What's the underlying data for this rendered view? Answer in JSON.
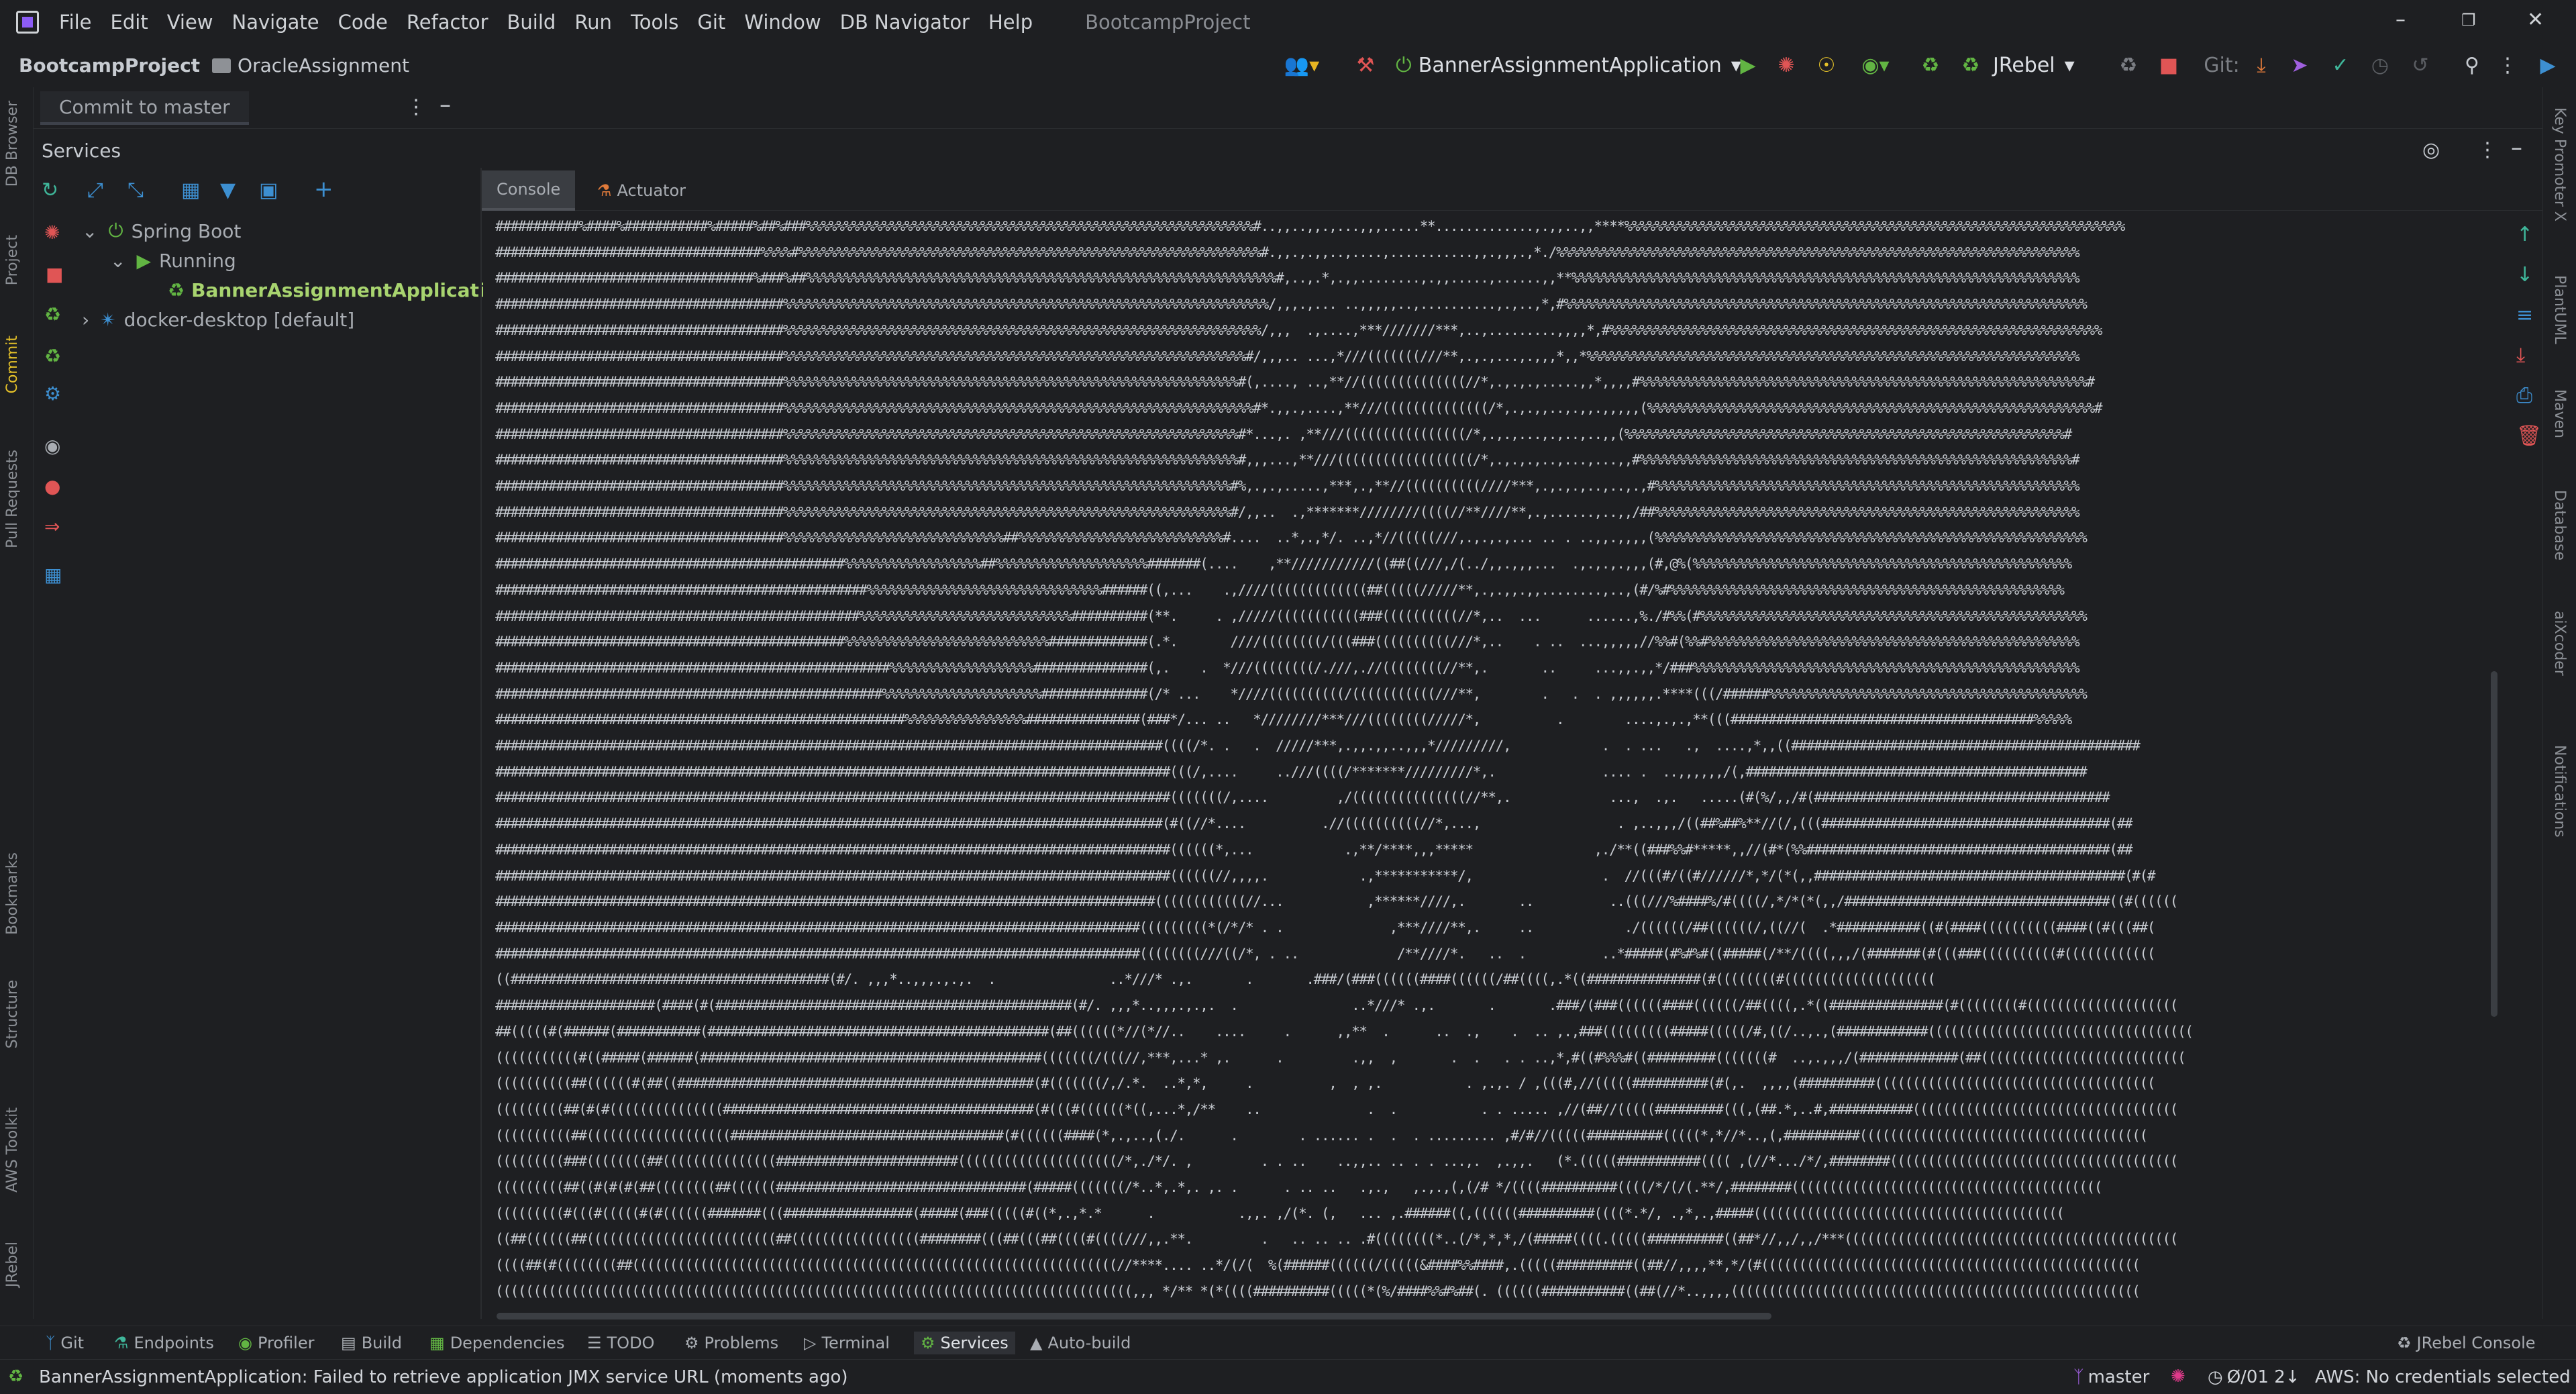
{
  "menubar": {
    "items": [
      "File",
      "Edit",
      "View",
      "Navigate",
      "Code",
      "Refactor",
      "Build",
      "Run",
      "Tools",
      "Git",
      "Window",
      "DB Navigator",
      "Help"
    ],
    "app_title": "BootcampProject"
  },
  "navbar": {
    "project": "BootcampProject",
    "folder": "OracleAssignment",
    "run_config": "BannerAssignmentApplication",
    "jrebel": "JRebel",
    "git_label": "Git:"
  },
  "left_tabs": {
    "db_browser": "DB Browser",
    "project": "Project",
    "commit": "Commit",
    "pull_requests": "Pull Requests",
    "bookmarks": "Bookmarks",
    "structure": "Structure",
    "aws_toolkit": "AWS Toolkit",
    "jrebel": "JRebel"
  },
  "right_tabs": {
    "key_promoter": "Key Promoter X",
    "plantuml": "PlantUML",
    "maven": "Maven",
    "database": "Database",
    "aixcoder": "aiXcoder",
    "notifications": "Notifications"
  },
  "commit_panel": {
    "tab_label": "Commit to master"
  },
  "services": {
    "header": "Services",
    "tree": [
      {
        "label": "Spring Boot"
      },
      {
        "label": "Running"
      },
      {
        "label": "BannerAssignmentApplication"
      },
      {
        "label": "docker-desktop [default]"
      }
    ]
  },
  "console_tabs": {
    "console": "Console",
    "actuator": "Actuator"
  },
  "console": {
    "lines": [
      "###########%####%###########%#####%##%###%%%%%%%%%%%%%%%%%%%%%%%%%%%%%%%%%%%%%%%%%%%%%%%%%%%%%%%%%%%#..,,..,,.,...,,,.....**.............,.,,..,,****%%%%%%%%%%%%%%%%%%%%%%%%%%%%%%%%%%%%%%%%%%%%%%%%%%%%%%%%%%%%%%%%%%",
      "###################################%%%%#%%%%%%%%%%%%%%%%%%%%%%%%%%%%%%%%%%%%%%%%%%%%%%%%%%%%%%%%%%%%%#.,,.,.,,..,....,...........,,.,,,.,*./%%%%%%%%%%%%%%%%%%%%%%%%%%%%%%%%%%%%%%%%%%%%%%%%%%%%%%%%%%%%%%%%%%%%%",
      "##################################%###%##%%%%%%%%%%%%%%%%%%%%%%%%%%%%%%%%%%%%%%%%%%%%%%%%%%%%%%%%%%%%%%#,..,.*,.,,........,.,,.....,......,,**%%%%%%%%%%%%%%%%%%%%%%%%%%%%%%%%%%%%%%%%%%%%%%%%%%%%%%%%%%%%%%%%%%%",
      "######################################%%%%%%%%%%%%%%%%%%%%%%%%%%%%%%%%%%%%%%%%%%%%%%%%%%%%%%%%%%%%%%%%/,,,.,... ..,,,,,..,..........,.,..,*,#%%%%%%%%%%%%%%%%%%%%%%%%%%%%%%%%%%%%%%%%%%%%%%%%%%%%%%%%%%%%%%%%%%%%%",
      "######################################%%%%%%%%%%%%%%%%%%%%%%%%%%%%%%%%%%%%%%%%%%%%%%%%%%%%%%%%%%%%%%%/,,,  .,....,***///////***,..,.........,,,,*,#%%%%%%%%%%%%%%%%%%%%%%%%%%%%%%%%%%%%%%%%%%%%%%%%%%%%%%%%%%%%%%%%%",
      "######################################%%%%%%%%%%%%%%%%%%%%%%%%%%%%%%%%%%%%%%%%%%%%%%%%%%%%%%%%%%%%%#/,,,.. ...,*///(((((((///**,.,.,...,.,,,*,,*%%%%%%%%%%%%%%%%%%%%%%%%%%%%%%%%%%%%%%%%%%%%%%%%%%%%%%%%%%%%%%%%%",
      "######################################%%%%%%%%%%%%%%%%%%%%%%%%%%%%%%%%%%%%%%%%%%%%%%%%%%%%%%%%%%%%#(,...., ..,**//((((((((((((((//*,.,.,.,.....,,*,,,,#%%%%%%%%%%%%%%%%%%%%%%%%%%%%%%%%%%%%%%%%%%%%%%%%%%%%%%%%%%%#",
      "######################################%%%%%%%%%%%%%%%%%%%%%%%%%%%%%%%%%%%%%%%%%%%%%%%%%%%%%%%%%%%%%%#*.,,.,....,**///((((((((((((((/*,.,.,,..,.,,.,,,,,(%%%%%%%%%%%%%%%%%%%%%%%%%%%%%%%%%%%%%%%%%%%%%%%%%%%%%%%%%%%#",
      "######################################%%%%%%%%%%%%%%%%%%%%%%%%%%%%%%%%%%%%%%%%%%%%%%%%%%%%%%%%%%%%#*...,. ,**///((((((((((((((((/*,.,.,...,.,..,..,,(%%%%%%%%%%%%%%%%%%%%%%%%%%%%%%%%%%%%%%%%%%%%%%%%%%%%%%%%%%#",
      "######################################%%%%%%%%%%%%%%%%%%%%%%%%%%%%%%%%%%%%%%%%%%%%%%%%%%%%%%%%%%%%#,,,...,**///((((((((((((((((((/*,.,.,.,..,...,...,,#%%%%%%%%%%%%%%%%%%%%%%%%%%%%%%%%%%%%%%%%%%%%%%%%%%%%%%%%%#",
      "######################################%%%%%%%%%%%%%%%%%%%%%%%%%%%%%%%%%%%%%%%%%%%%%%%%%%%%%%%%%%%#%,.,.,.....,***,.,**//((((((((((////***,.,.,.,..,..,.,#%%%%%%%%%%%%%%%%%%%%%%%%%%%%%%%%%%%%%%%%%%%%%%%%%%%%%%%%",
      "######################################%%%%%%%%%%%%%%%%%%%%%%%%%%%%%%%%%%%%%%%%%%%%%%%%%%%%%%%%%%%#/,,..  .,*******////////((((//**////**,.,......,..,,/##%%%%%%%%%%%%%%%%%%%%%%%%%%%%%%%%%%%%%%%%%%%%%%%%%%%%%%%%",
      "######################################%%%%%%%%%%%%%%%%%%%%%%%%%%%%%##%%%%%%%%%%%%%%%%%%%%%%%%%%%#....  ..*,.,*/. ..,*//(((((///,.,.,.,... .. . ..,,.,,,,(%%%%%%%%%%%%%%%%%%%%%%%%%%%%%%%%%%%%%%%%%%%%%%%%%%%%%%%%%",
      "##############################################%%%%%%%%%%%%%%%%%%##%%%%%%%%%%%%%%%%%%%%#######(....    ,**///////////((##((///,/(../,,.,,,...  .,.,.,.,,,(#,@%(%%%%%%%%%%%%%%%%%%%%%%%%%%%%%%%%%%%%%%%%%%%%%%%%%%",
      "#################################################%%%%%%%%%%%%%%%%%%%%%%%%%%%%%%%######((,...    .,////(((((((((((((##(((((/////**,.,.,,.,,........,..,(#/%#%%%%%%%%%%%%%%%%%%%%%%%%%%%%%%%%%%%%%%%%%%%%%%%%%%%%",
      "################################################%%%%%%%%%%%%%%%%%%%%%%%%%%%%##########(**.     . ,/////(((((((((((###((((((((((//*,..  ...      ......,%./#%%(#%%%%%%%%%%%%%%%%%%%%%%%%%%%%%%%%%%%%%%%%%%%%%%%%%%%",
      "##############################################%%%%%%%%%%%%%%%%%%%%%%%%%%%#############(.*.       ////((((((((/(((###((((((((((///*,..    . ..  ...,,,,,//%%#(%%#%%%%%%%%%%%%%%%%%%%%%%%%%%%%%%%%%%%%%%%%%%%%%%%%%",
      "####################################################%%%%%%%%%%%%%%%%%%%###############(,.    .  *///((((((((/.///,.//((((((((//**,.       ..     ...,,.,,*/###%%%%%%%%%%%%%%%%%%%%%%%%%%%%%%%%%%%%%%%%%%%%%%%%%%%",
      "###################################################%%%%%%%%%%%%%%%%%%%%%##############(/* ...    *////((((((((((/(((((((((((///**,        .   .  . ,,,,,,.****(((/######%%%%%%%%%%%%%%%%%%%%%%%%%%%%%%%%%%%%%%%%%%",
      "######################################################%%%%%%%%%%%%%%%%###############(###*/... ..   *////////***///((((((((/////*,          .        ....,.,.,**(((########################################%%%%%",
      "########################################################################################((((/*. .   .  /////***,.,,.,,..,,,*/////////,            .  . ...   .,  ....,*,,((##############################################",
      "#########################################################################################(((/,....     ..///((((/*******/////////*,.              .... .  ..,,,,,,/(,#############################################",
      "#########################################################################################(((((((/,....         ,/(((((((((((((((//**,.             ...,  .,.   .....(#(%/,,/#(#######################################",
      "########################################################################################(#((//*....          .//((((((((((//*,...,                  . ,..,,,/((##%##%**//(/,(((######################################(##",
      "#########################################################################################((((((*,...            .,**/****,,,*****                ,./**((###%%#*****,,//(#*(%%########################################(##",
      "#########################################################################################((((((//,,,,.            .,***********/,                 .  //(((#/((#//////*,*/(*(,,#########################################(#(#",
      "#######################################################################################((((((((((((//...           ,******////,.       ..          ..(((///%####%/#((((/,*/*(*(,,/###################################((#((((((",
      "#####################################################################################(((((((((*(/*/* . .              ,***////**,.     ..            ./((((((/##((((((/,((//(  .*###########((#(####((((((((((####((#(((##(",
      "#####################################################################################((((((((///((/*, . ..             /**////*.   ..  .          ..*#####(#%#%#((#####(/**/((((,,,/(#######(#(((###((((((((((#((((((((((((",
      "((##########################################(#/. ,,,*..,,,.,.,.  .               ..*///* .,.       .       .###/(###((((((####((((((/##((((,.*((###############(#((((((((#((((((((((((((((((((",
      "#####################(####(#(###############################################(#/. ,,,*..,,,.,.,.  .               ..*///* .,.       .       .###/(###((((((####((((((/##((((,.*((###############(#((((((((#((((((((((((((((((((",
      "##(((((#(######(###########(#############################################(##((((((*//(*//..    ....     .      ,,**  .      ..  .,    .  .. ,.,###(((((((((#####(((((/#,((/..,.,(############(((((((((((((((((((((((((((((((((((",
      "(((((((((((#((#####(######(#############################################(((((((/(((//,***,...* ,.      .         .,,  ,       .  .   . . ..,*,#((#%%%#((#########(((((((#  ..,.,,,/(#############(##(((((((((((((((((((((((((((",
      "((((((((((##((((((#(##((###############################################(#(((((((/,/.*.  ..*,*,     .          ,  , ,.           . ,.,. / ,(((#,//(((((##########(#(,.  ,,,,(##########(((((((((((((((((((((((((((((((((((((",
      "(((((((((##(#(#(((((((((((((((#########################################(#(((#((((((*((,...*,/**    ..              .  .           . . ..... ,//(##//(((((#########(((,(##.*,..#,###########(((((((((((((((((((((((((((((((((((",
      "((((((((((##(((((((((((((((((((####################################(#((((((####(*,.,..,(./.      .        . ...... .  .  . ......... ,#/#//(((((##########(((((*,*//*..,(,##########((((((((((((((((((((((((((((((((((((((",
      "(((((((((###((((((((##(((((((((((((((########################(((((((((((((((((((((/*,./*/. ,         . . ..    ..,,.. .. . . ...,.  ,.,,.   (*.(((((###########(((( ,(//*.../*/,########((((((((((((((((((((((((((((((((((((((",
      "(((((((((##((#(#(#(##((((((((##((((((#################################(#####(((((((/*..*,.*,. ,. .      . .. ..   .,.,   ,.,.,(,(/# */((((##########((((/*/(/(.**/,########(((((((((((((((((((((((((((((((((((((((((",
      "(((((((((#(((#(((((#(#((((((#######(((#################(#####(###(((((#((*,.,*.*      .           .,,. ,/(*. (,   ... ,.######((,((((((##########((((*.*/, .,*,.,#####(((((((((((((((((((((((((((((((((((((((((",
      "((##((((((##(((((((((((((((((((((((((##(((((((((((((((((########(((##(((##((((#((((///,,.**.         .   .. .. .. .#((((((((*..(/*,*,*,/(#####((((.(((((##########((##*//,,/,,/***((((((((((((((((((((((((((((((((((((((((((((",
      "((((##(#((((((((##((((((((((((((((((((((((((((((((((((((((((((((((((((((((((((((((//****.... ..*/(/(  %(######((((((/(((((&####%%####,.(((((##########((##//,,,,**,*/(#((((((((((((((((((((((((((((((((((((((((((((((((((",
      "((((((((((((((((((((((((((((((((((((((((((((((((((((((((((((((((((((((((((((((((((((,,, */** *(*((((##########(((((*(%/####%%#%##(. ((((((###########((##(//*..,,,,(((((((((((((((((((((((((((((((((((((((((((((((((((((("
    ]
  },
  "bottom_tools": {
    "git": "Git",
    "endpoints": "Endpoints",
    "profiler": "Profiler",
    "build": "Build",
    "dependencies": "Dependencies",
    "todo": "TODO",
    "problems": "Problems",
    "terminal": "Terminal",
    "services": "Services",
    "auto_build": "Auto-build",
    "jrebel_console": "JRebel Console"
  },
  "status_bar": {
    "message": "BannerAssignmentApplication: Failed to retrieve application JMX service URL (moments ago)",
    "branch": "master",
    "vcs_changes": "Ø/01 2↓",
    "aws": "AWS: No credentials selected"
  },
  "colors": {
    "background": "#1e1f22",
    "accent_green": "#62b543",
    "accent_red": "#e05555",
    "run_config_green": "#a8d46f",
    "link_blue": "#3d8fd1"
  }
}
